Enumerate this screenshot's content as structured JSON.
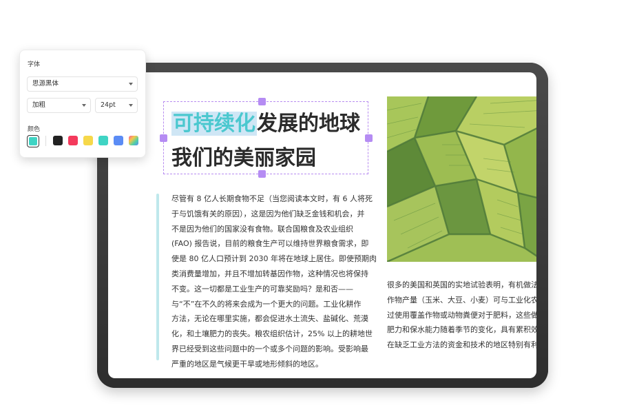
{
  "panel": {
    "font_label": "字体",
    "font_family": "思源黑体",
    "font_weight": "加粗",
    "font_size": "24pt",
    "color_label": "颜色",
    "current_color": "#3fd4c4",
    "swatches": [
      "#222222",
      "#f43a5c",
      "#f6d84a",
      "#3fd4c4",
      "#5b8cf5",
      "rainbow-gradient"
    ]
  },
  "document": {
    "heading_highlight": "可持续化",
    "heading_rest": "发展的地球",
    "heading_line2": "我们的美丽家园",
    "left_lines": [
      "尽管有 8 亿人长期食物不足（当您阅读本文时，有 6 人将死",
      "于与饥饿有关的原因），这是因为他们缺乏金钱和机会，并",
      "不是因为他们的国家没有食物。联合国粮食及农业组织",
      "(FAO) 报告说，目前的粮食生产可以维持世界粮食需求，即",
      "使是 80 亿人口预计到 2030 年将在地球上居住。即使预期肉",
      "类消费量增加，并且不增加转基因作物，这种情况也将保持",
      "不变。这一切都是工业生产的可靠奖励吗？是和否——",
      "与“不”在不久的将来会成为一个更大的问题。工业化耕作",
      "方法，无论在哪里实施，都会促进水土流失、盐碱化、荒漠",
      "化，和土壤肥力的丧失。粮农组织估计，25% 以上的耕地世",
      "界已经受到这些问题中的一个或多个问题的影响。受影响最",
      "严重的地区是气候更干旱或地形倾斜的地区。"
    ],
    "right_lines": [
      "很多的美国和英国的实地试验表明，有机做法可",
      "作物产量（玉米、大豆、小麦）可与工业化农场",
      "过使用覆盖作物或动物粪便对于肥料，这些做法",
      "肥力和保水能力随着季节的变化，具有累积效益",
      "在缺乏工业方法的资金和技术的地区特别有利。"
    ]
  }
}
